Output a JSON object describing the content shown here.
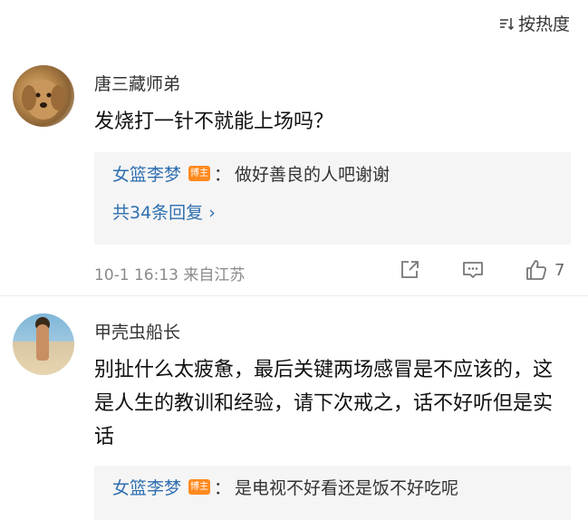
{
  "sort": {
    "label": "按热度",
    "icon": "sort-icon"
  },
  "comments": [
    {
      "username": "唐三藏师弟",
      "text": "发烧打一针不就能上场吗？",
      "reply": {
        "author": "女篮李梦",
        "badge": "博主",
        "colon": "：",
        "text": "做好善良的人吧谢谢"
      },
      "reply_count": "共34条回复 ›",
      "timestamp": "10-1 16:13",
      "source": "来自江苏",
      "likes": "7"
    },
    {
      "username": "甲壳虫船长",
      "text": "别扯什么太疲惫，最后关键两场感冒是不应该的，这是人生的教训和经验，请下次戒之，话不好听但是实话",
      "reply": {
        "author": "女篮李梦",
        "badge": "博主",
        "colon": "：",
        "text": "是电视不好看还是饭不好吃呢"
      }
    }
  ],
  "colors": {
    "link": "#2f6fb0",
    "badge": "#ff8a1f",
    "reply_bg": "#f5f5f5"
  }
}
